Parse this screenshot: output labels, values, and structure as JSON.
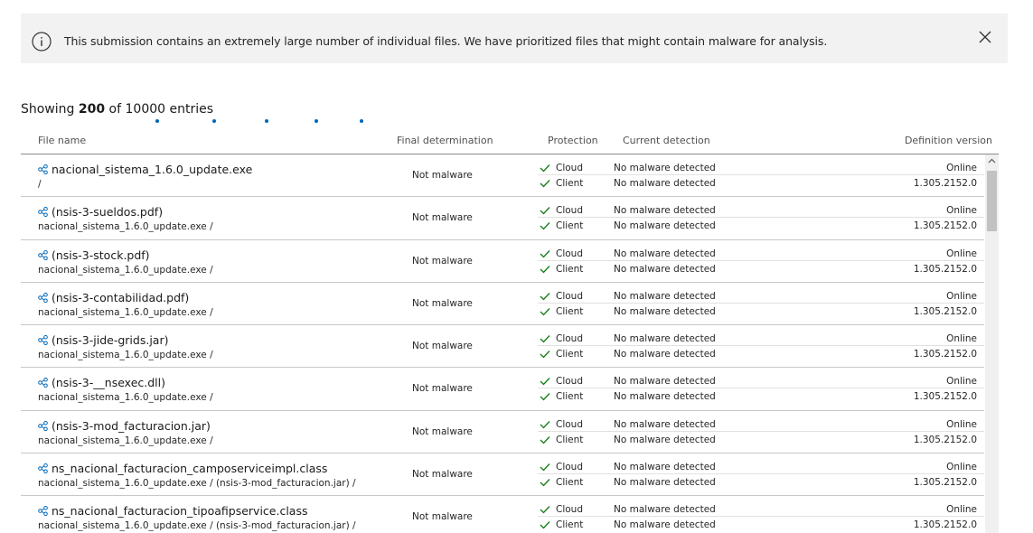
{
  "banner": {
    "message": "This submission contains an extremely large number of individual files. We have prioritized files that might contain malware for analysis.",
    "icon": "info-icon",
    "close_icon": "close-icon"
  },
  "summary": {
    "prefix": "Showing ",
    "count": "200",
    "suffix": " of 10000 entries"
  },
  "columns": {
    "file_name": "File name",
    "final_determination": "Final determination",
    "protection": "Protection",
    "current_detection": "Current detection",
    "definition_version": "Definition version"
  },
  "rows": [
    {
      "name": "nacional_sistema_1.6.0_update.exe",
      "path": "/",
      "final": "Not malware",
      "prot1": "Cloud",
      "prot2": "Client",
      "det1": "No malware detected",
      "det2": "No malware detected",
      "ver1": "Online",
      "ver2": "1.305.2152.0"
    },
    {
      "name": "(nsis-3-sueldos.pdf)",
      "path": "nacional_sistema_1.6.0_update.exe /",
      "final": "Not malware",
      "prot1": "Cloud",
      "prot2": "Client",
      "det1": "No malware detected",
      "det2": "No malware detected",
      "ver1": "Online",
      "ver2": "1.305.2152.0"
    },
    {
      "name": "(nsis-3-stock.pdf)",
      "path": "nacional_sistema_1.6.0_update.exe /",
      "final": "Not malware",
      "prot1": "Cloud",
      "prot2": "Client",
      "det1": "No malware detected",
      "det2": "No malware detected",
      "ver1": "Online",
      "ver2": "1.305.2152.0"
    },
    {
      "name": "(nsis-3-contabilidad.pdf)",
      "path": "nacional_sistema_1.6.0_update.exe /",
      "final": "Not malware",
      "prot1": "Cloud",
      "prot2": "Client",
      "det1": "No malware detected",
      "det2": "No malware detected",
      "ver1": "Online",
      "ver2": "1.305.2152.0"
    },
    {
      "name": "(nsis-3-jide-grids.jar)",
      "path": "nacional_sistema_1.6.0_update.exe /",
      "final": "Not malware",
      "prot1": "Cloud",
      "prot2": "Client",
      "det1": "No malware detected",
      "det2": "No malware detected",
      "ver1": "Online",
      "ver2": "1.305.2152.0"
    },
    {
      "name": "(nsis-3-__nsexec.dll)",
      "path": "nacional_sistema_1.6.0_update.exe /",
      "final": "Not malware",
      "prot1": "Cloud",
      "prot2": "Client",
      "det1": "No malware detected",
      "det2": "No malware detected",
      "ver1": "Online",
      "ver2": "1.305.2152.0"
    },
    {
      "name": "(nsis-3-mod_facturacion.jar)",
      "path": "nacional_sistema_1.6.0_update.exe /",
      "final": "Not malware",
      "prot1": "Cloud",
      "prot2": "Client",
      "det1": "No malware detected",
      "det2": "No malware detected",
      "ver1": "Online",
      "ver2": "1.305.2152.0"
    },
    {
      "name": "ns_nacional_facturacion_camposerviceimpl.class",
      "path": "nacional_sistema_1.6.0_update.exe / (nsis-3-mod_facturacion.jar) /",
      "final": "Not malware",
      "prot1": "Cloud",
      "prot2": "Client",
      "det1": "No malware detected",
      "det2": "No malware detected",
      "ver1": "Online",
      "ver2": "1.305.2152.0"
    },
    {
      "name": "ns_nacional_facturacion_tipoafipservice.class",
      "path": "nacional_sistema_1.6.0_update.exe / (nsis-3-mod_facturacion.jar) /",
      "final": "Not malware",
      "prot1": "Cloud",
      "prot2": "Client",
      "det1": "No malware detected",
      "det2": "No malware detected",
      "ver1": "Online",
      "ver2": "1.305.2152.0"
    }
  ],
  "colors": {
    "accent": "#0067b8",
    "check": "#107c10",
    "banner_bg": "#f2f2f2"
  }
}
